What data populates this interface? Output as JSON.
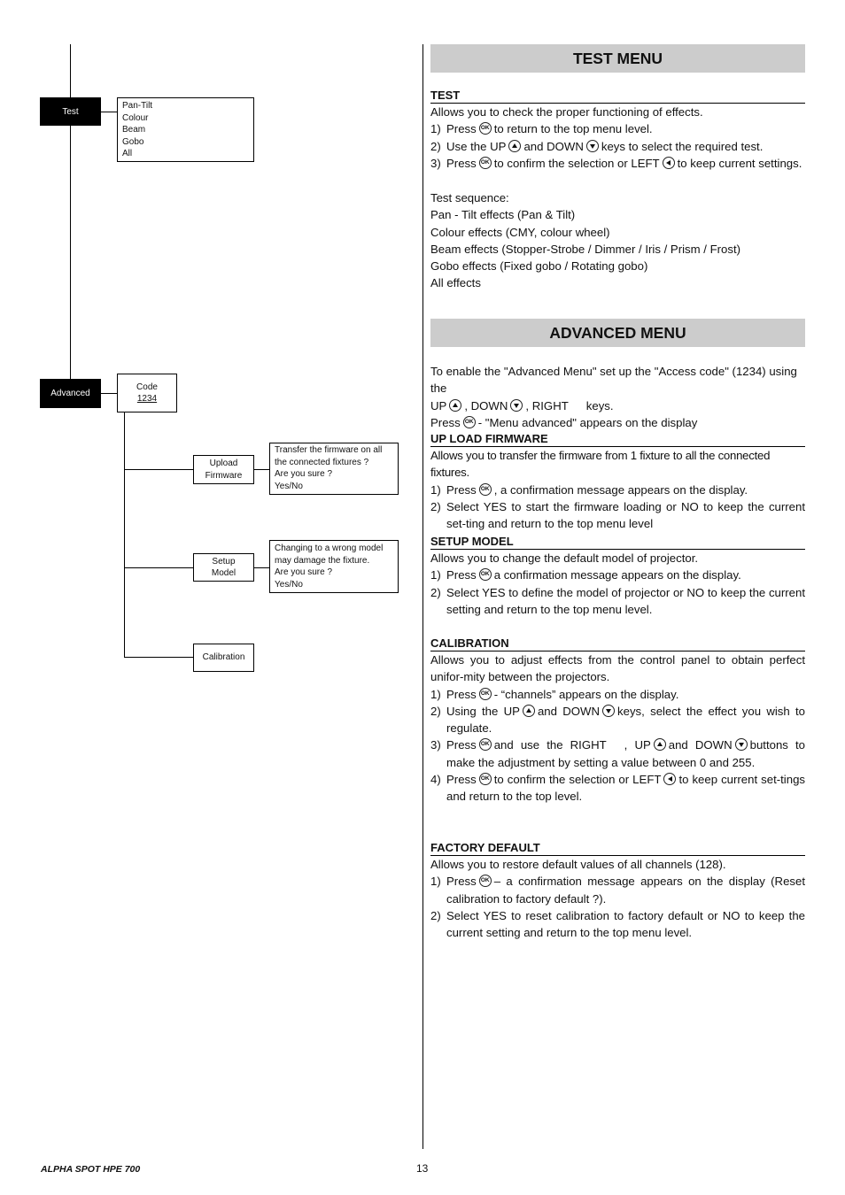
{
  "diagram": {
    "test_node": "Test",
    "test_options": [
      "Pan-Tilt",
      "Colour",
      "Beam",
      "Gobo",
      "All"
    ],
    "advanced_node": "Advanced",
    "code_box": {
      "label": "Code",
      "value": "1234"
    },
    "upload_firmware": {
      "label_line1": "Upload",
      "label_line2": "Firmware",
      "message": [
        "Transfer the firmware on all",
        "the connected fixtures ?",
        "Are you sure ?",
        "Yes/No"
      ]
    },
    "setup_model": {
      "label_line1": "Setup",
      "label_line2": "Model",
      "message": [
        "Changing to a wrong model",
        "may damage the fixture.",
        "Are you sure ?",
        "Yes/No"
      ]
    },
    "calibration": {
      "label": "Calibration"
    }
  },
  "test_menu": {
    "banner": "TEST MENU",
    "heading": "TEST",
    "intro": "Allows you to check the proper functioning of effects.",
    "steps": [
      {
        "num": "1)",
        "a": "Press",
        "b": "to return to the top menu level."
      },
      {
        "num": "2)",
        "a": "Use the UP",
        "b": "and DOWN",
        "c": "keys to select the required test."
      },
      {
        "num": "3)",
        "a": "Press",
        "b": "to confirm the selection or LEFT",
        "c": "to keep current settings."
      }
    ],
    "sequence_title": "Test sequence:",
    "sequence": [
      "Pan - Tilt effects (Pan & Tilt)",
      "Colour effects (CMY, colour wheel)",
      "Beam effects (Stopper-Strobe / Dimmer / Iris / Prism / Frost)",
      "Gobo effects (Fixed gobo / Rotating gobo)",
      "All effects"
    ]
  },
  "advanced_menu": {
    "banner": "ADVANCED MENU",
    "intro_line1": "To enable the \"Advanced Menu\" set up the \"Access code\" (1234) using the",
    "intro_up": "UP",
    "intro_down": ", DOWN",
    "intro_right": ", RIGHT",
    "intro_keys": "keys.",
    "intro_press": "Press",
    "intro_press_rest": "- \"Menu advanced\" appears on the display",
    "upload_firmware": {
      "heading": "UP LOAD FIRMWARE",
      "intro": "Allows you to transfer the firmware from 1 fixture to all the connected fixtures.",
      "step1_num": "1)",
      "step1_a": "Press",
      "step1_b": ", a confirmation message appears on the display.",
      "step2_num": "2)",
      "step2": "Select YES to start the firmware loading or NO to keep the current set-ting and return to the top menu level"
    },
    "setup_model": {
      "heading": "SETUP MODEL",
      "intro": "Allows you to change the default model of projector.",
      "step1_num": "1)",
      "step1_a": "Press",
      "step1_b": "a confirmation message appears on the display.",
      "step2_num": "2)",
      "step2": "Select YES to define the model of projector or NO to keep the current setting and return to the top menu level."
    },
    "calibration": {
      "heading": "CALIBRATION",
      "intro": "Allows you to adjust effects from the control panel to obtain perfect unifor-mity between the projectors.",
      "step1_num": "1)",
      "step1_a": "Press",
      "step1_b": "-  “channels” appears on the display.",
      "step2_num": "2)",
      "step2_a": "Using the UP",
      "step2_b": "and DOWN",
      "step2_c": "keys, select the effect you wish to regulate.",
      "step3_num": "3)",
      "step3_a": "Press",
      "step3_b": "and use the RIGHT",
      "step3_c": ", UP",
      "step3_d": "and DOWN",
      "step3_e": "buttons to make the adjustment by setting a value between 0 and 255.",
      "step4_num": "4)",
      "step4_a": "Press",
      "step4_b": "to confirm the selection or LEFT",
      "step4_c": "to keep current set-tings and return to the top level."
    },
    "factory_default": {
      "heading": "FACTORY DEFAULT",
      "intro": "Allows you to restore default values of all channels (128).",
      "step1_num": "1)",
      "step1_a": "Press",
      "step1_b": "– a confirmation message appears on the display (Reset calibration to factory default ?).",
      "step2_num": "2)",
      "step2": "Select YES to reset calibration to factory default or NO to keep the current setting and return to the top menu level."
    }
  },
  "footer": {
    "product": "ALPHA SPOT HPE 700",
    "page": "13"
  }
}
